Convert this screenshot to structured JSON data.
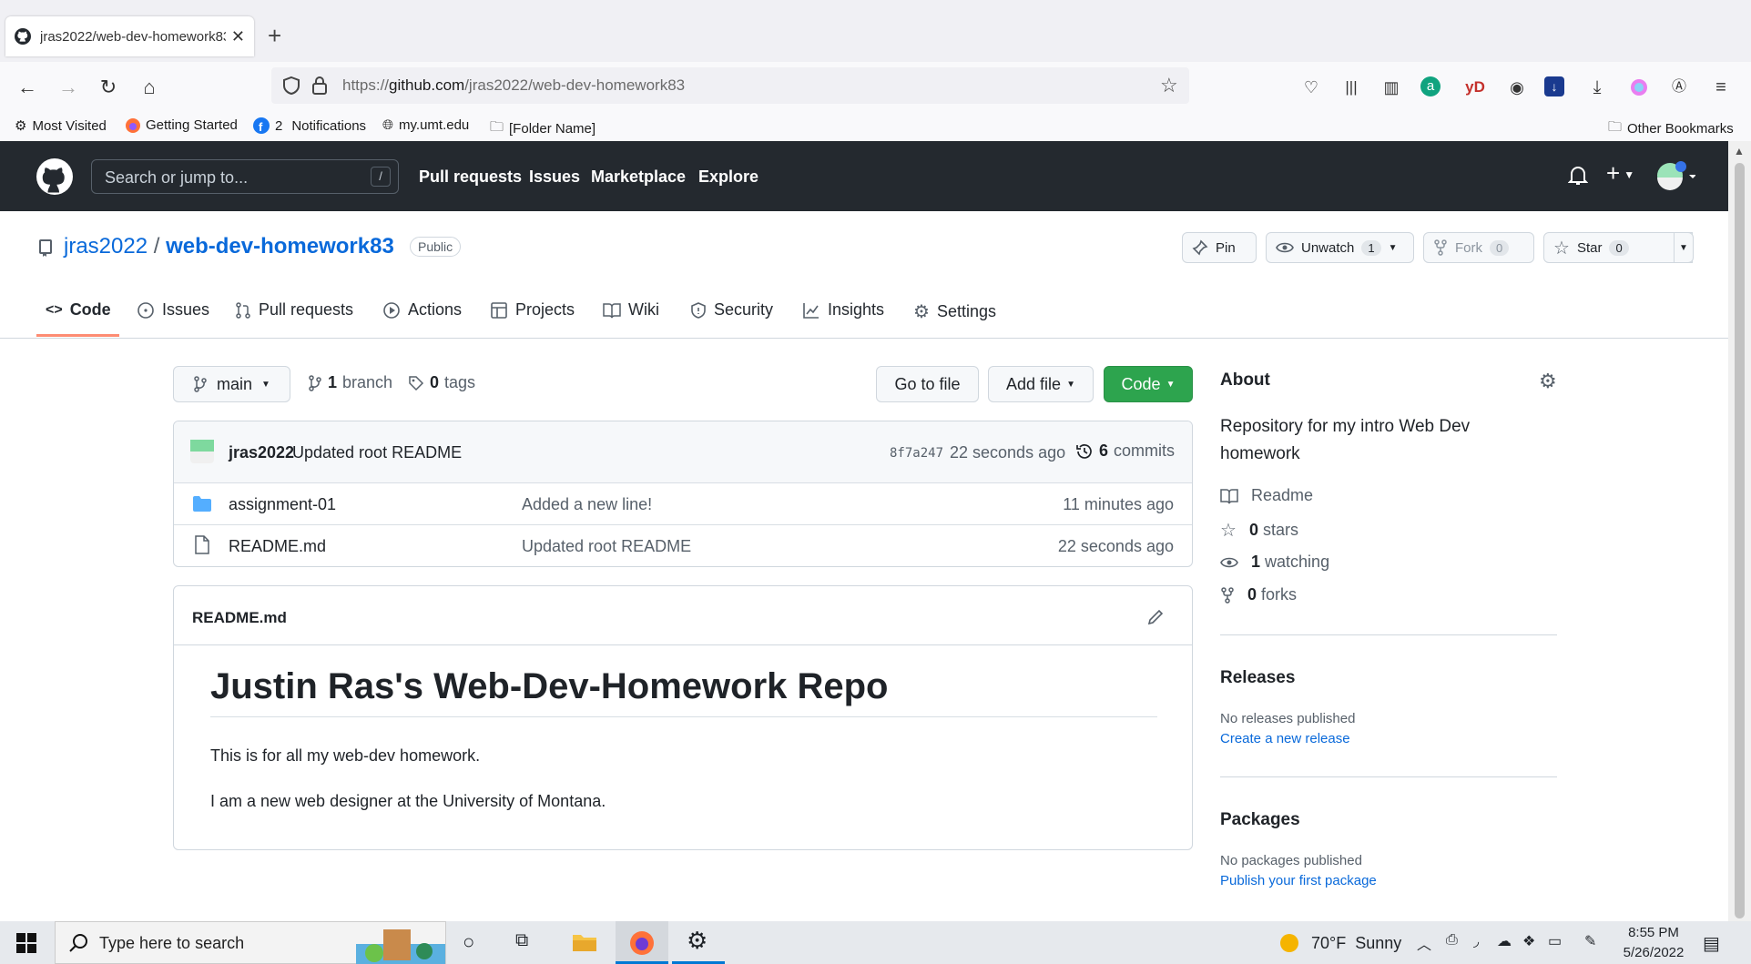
{
  "browser": {
    "tab_title": "jras2022/web-dev-homework83",
    "url_prefix": "https://",
    "url_host": "github.com",
    "url_path": "/jras2022/web-dev-homework83",
    "bookmarks": [
      "Most Visited",
      "Getting Started",
      "2",
      "Notifications",
      "my.umt.edu",
      "[Folder Name]"
    ],
    "other_bookmarks": "Other Bookmarks"
  },
  "github_header": {
    "search_placeholder": "Search or jump to...",
    "search_shortcut": "/",
    "nav": [
      "Pull requests",
      "Issues",
      "Marketplace",
      "Explore"
    ]
  },
  "repo": {
    "owner": "jras2022",
    "separator": "/",
    "name": "web-dev-homework83",
    "visibility": "Public",
    "pin_label": "Pin",
    "unwatch_label": "Unwatch",
    "unwatch_count": "1",
    "fork_label": "Fork",
    "fork_count": "0",
    "star_label": "Star",
    "star_count": "0",
    "tabs": [
      "Code",
      "Issues",
      "Pull requests",
      "Actions",
      "Projects",
      "Wiki",
      "Security",
      "Insights",
      "Settings"
    ]
  },
  "toolbar": {
    "branch": "main",
    "branch_count": "1",
    "branch_word": "branch",
    "tag_count": "0",
    "tag_word": "tags",
    "go_to_file": "Go to file",
    "add_file": "Add file",
    "code": "Code"
  },
  "commit": {
    "author": "jras2022",
    "message": "Updated root README",
    "sha": "8f7a247",
    "time": "22 seconds ago",
    "count": "6",
    "count_word": "commits"
  },
  "files": [
    {
      "name": "assignment-01",
      "message": "Added a new line!",
      "time": "11 minutes ago",
      "type": "folder"
    },
    {
      "name": "README.md",
      "message": "Updated root README",
      "time": "22 seconds ago",
      "type": "file"
    }
  ],
  "readme": {
    "filename": "README.md",
    "heading": "Justin Ras's Web-Dev-Homework Repo",
    "p1": "This is for all my web-dev homework.",
    "p2": "I am a new web designer at the University of Montana."
  },
  "about": {
    "title": "About",
    "description": "Repository for my intro Web Dev homework",
    "readme": "Readme",
    "stars_count": "0",
    "stars_word": "stars",
    "watching_count": "1",
    "watching_word": "watching",
    "forks_count": "0",
    "forks_word": "forks"
  },
  "releases": {
    "title": "Releases",
    "none": "No releases published",
    "link": "Create a new release"
  },
  "packages": {
    "title": "Packages",
    "none": "No packages published",
    "link": "Publish your first package"
  },
  "taskbar": {
    "search_placeholder": "Type here to search",
    "weather": "70°F  Sunny",
    "time": "8:55 PM",
    "date": "5/26/2022"
  },
  "colors": {
    "accent_green": "#2da44e",
    "link_blue": "#0969da",
    "header_dark": "#24292f",
    "tab_underline": "#fd8c73"
  }
}
